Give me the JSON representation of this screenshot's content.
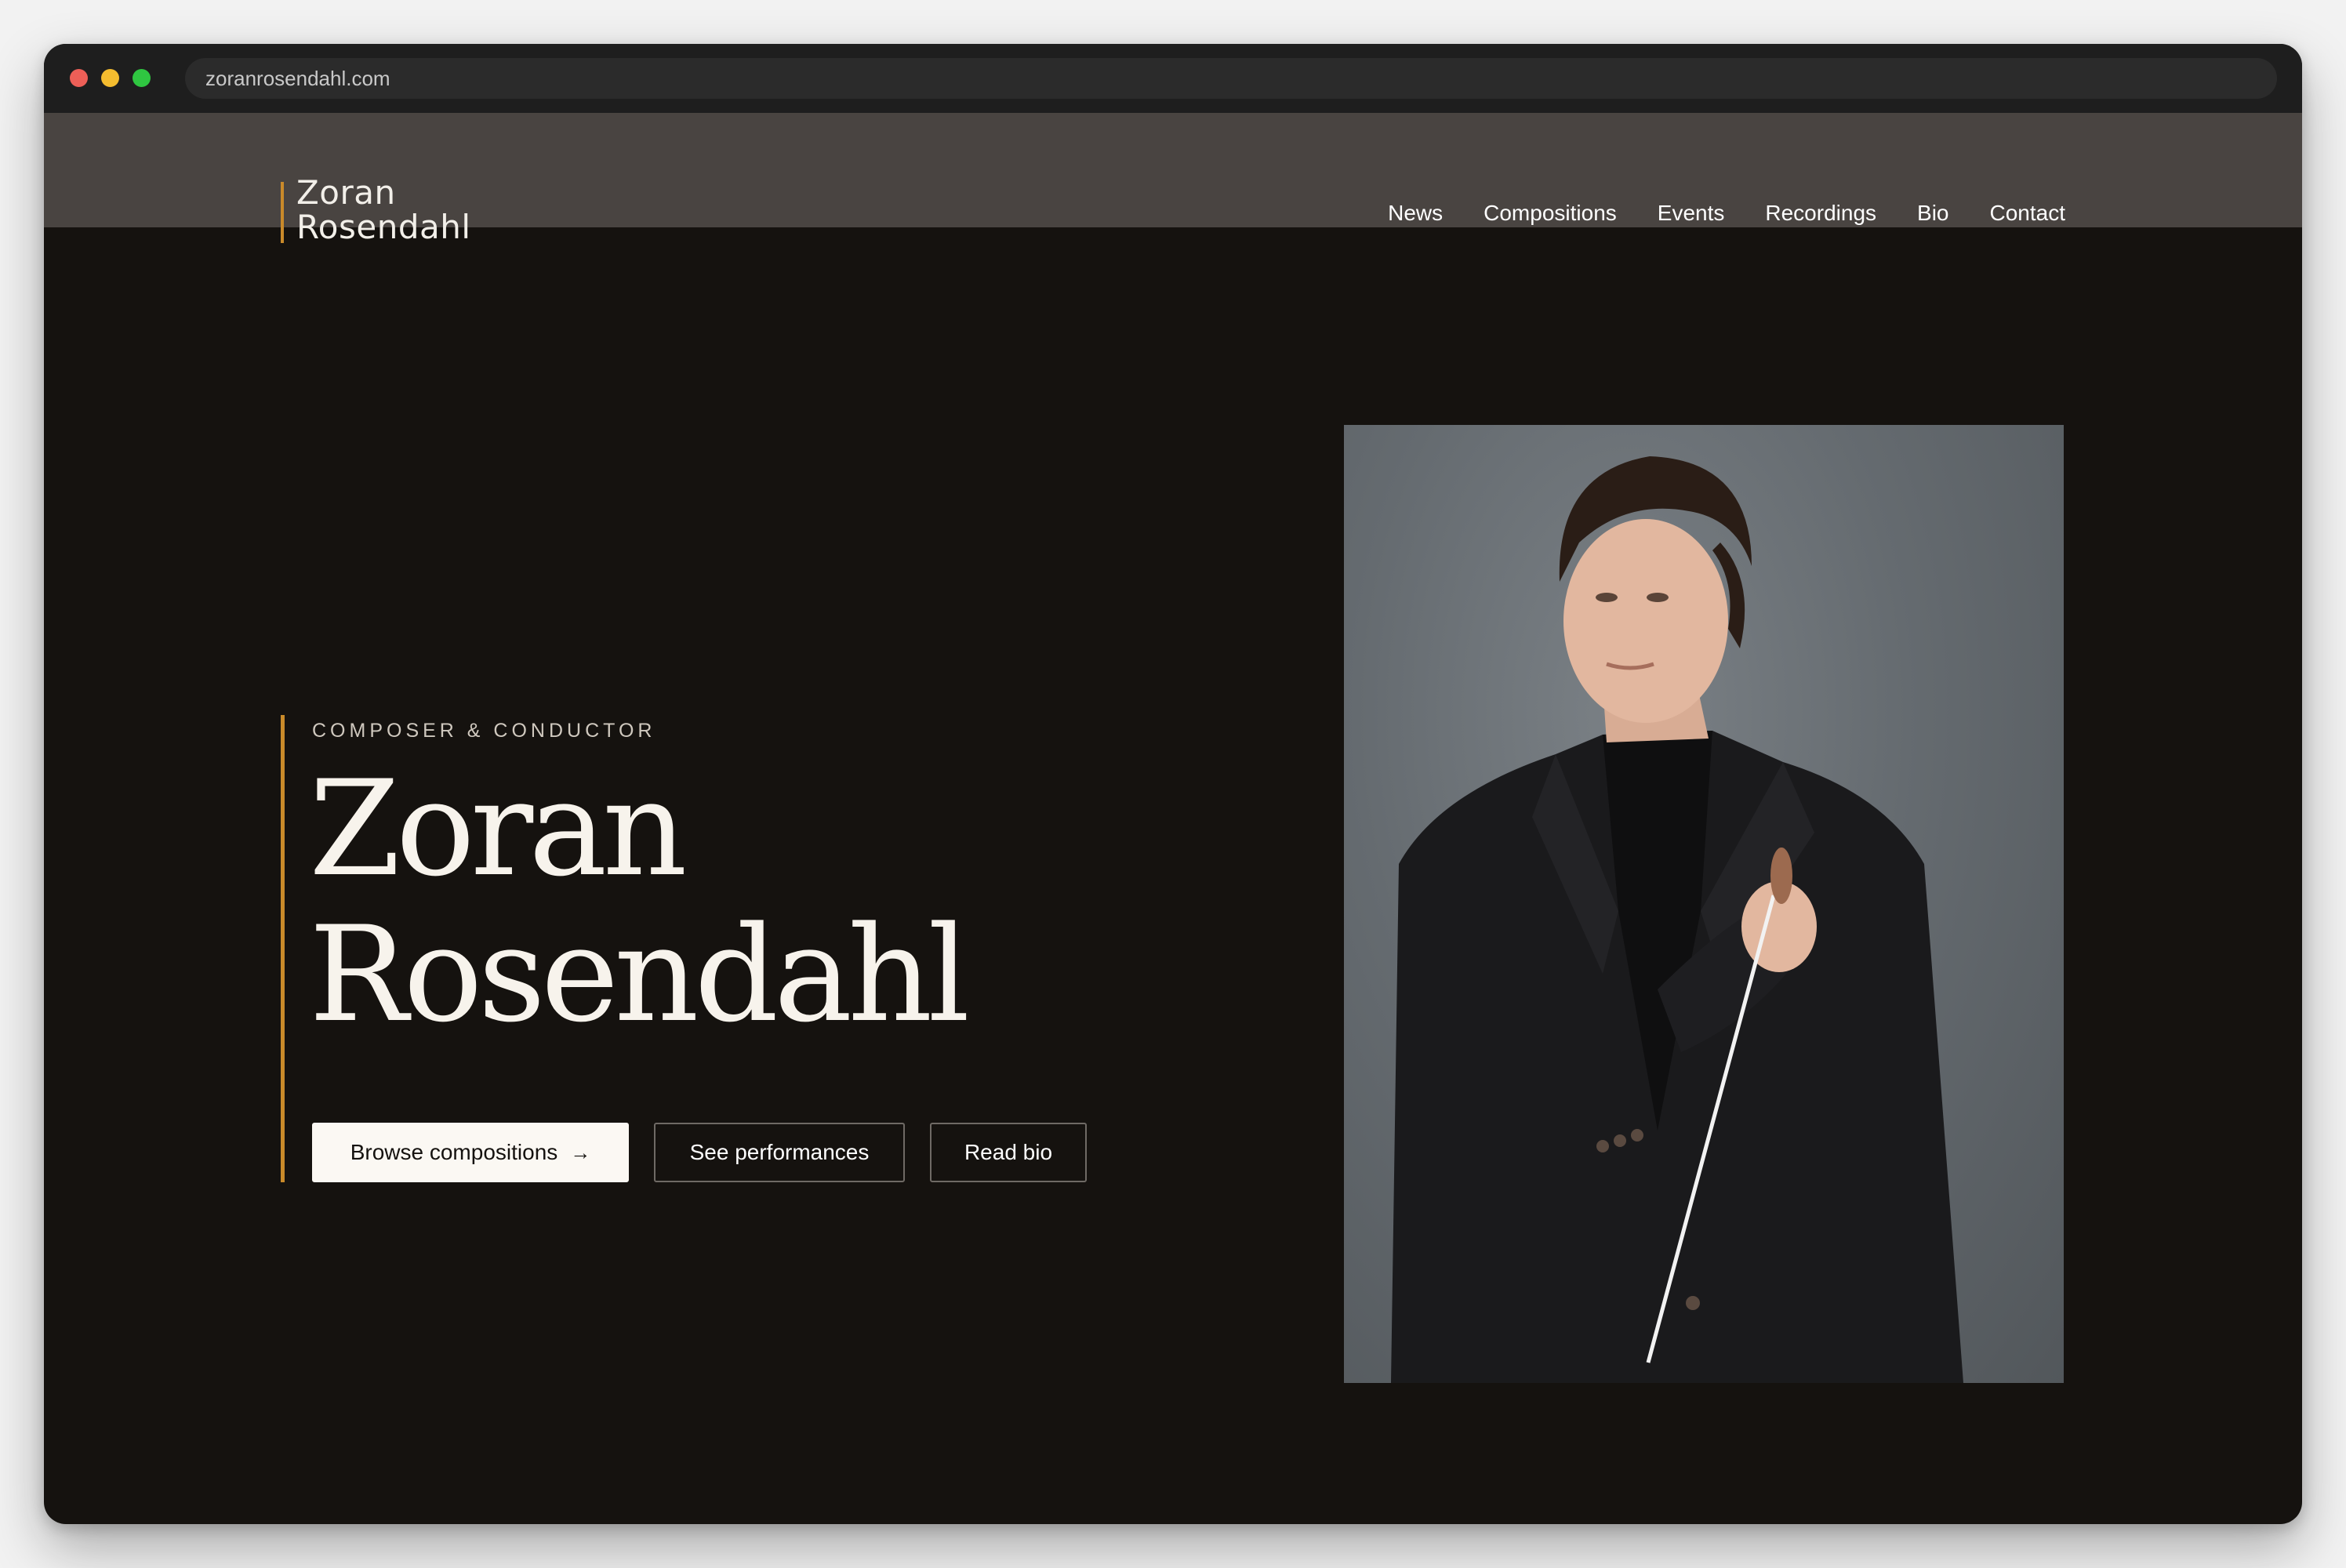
{
  "browser": {
    "url": "zoranrosendahl.com"
  },
  "site": {
    "logo_line1": "Zoran",
    "logo_line2": "Rosendahl",
    "nav": [
      "News",
      "Compositions",
      "Events",
      "Recordings",
      "Bio",
      "Contact"
    ]
  },
  "hero": {
    "eyebrow": "COMPOSER & CONDUCTOR",
    "title_line1": "Zoran",
    "title_line2": "Rosendahl",
    "buttons": {
      "primary": "Browse compositions",
      "primary_icon": "arrow-right-icon",
      "secondary1": "See performances",
      "secondary2": "Read bio"
    }
  },
  "colors": {
    "accent": "#c98a2a",
    "background": "#15120f",
    "header": "#494441"
  }
}
